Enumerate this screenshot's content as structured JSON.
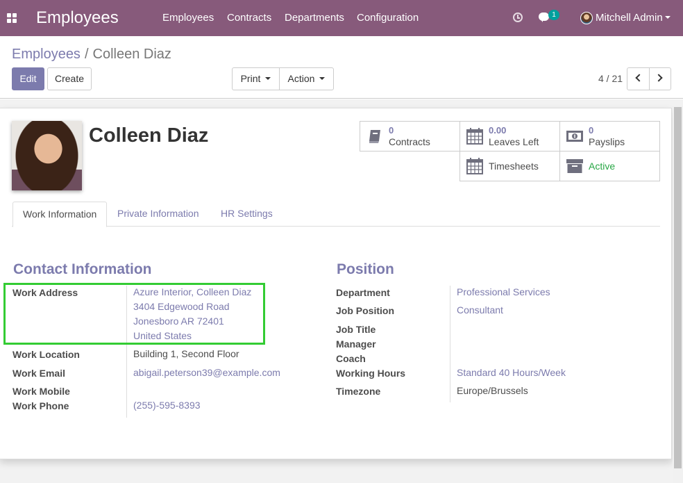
{
  "navbar": {
    "brand": "Employees",
    "menu": [
      "Employees",
      "Contracts",
      "Departments",
      "Configuration"
    ],
    "messages_count": "1",
    "user_name": "Mitchell Admin"
  },
  "breadcrumb": {
    "parent": "Employees",
    "separator": "/",
    "current": "Colleen Diaz"
  },
  "toolbar": {
    "edit_label": "Edit",
    "create_label": "Create",
    "print_label": "Print",
    "action_label": "Action"
  },
  "pager": {
    "value": "4 / 21"
  },
  "employee": {
    "name": "Colleen Diaz"
  },
  "smart_buttons": {
    "contracts": {
      "value": "0",
      "label": "Contracts"
    },
    "leaves": {
      "value": "0.00",
      "label": "Leaves Left"
    },
    "payslips": {
      "value": "0",
      "label": "Payslips"
    },
    "timesheets": {
      "label": "Timesheets"
    },
    "status": {
      "label": "Active"
    }
  },
  "tabs": [
    "Work Information",
    "Private Information",
    "HR Settings"
  ],
  "contact": {
    "title": "Contact Information",
    "work_address_label": "Work Address",
    "work_address": [
      "Azure Interior, Colleen Diaz",
      "3404 Edgewood Road",
      "Jonesboro AR 72401",
      "United States"
    ],
    "work_location_label": "Work Location",
    "work_location": "Building 1, Second Floor",
    "work_email_label": "Work Email",
    "work_email": "abigail.peterson39@example.com",
    "work_mobile_label": "Work Mobile",
    "work_phone_label": "Work Phone",
    "work_phone": "(255)-595-8393"
  },
  "position": {
    "title": "Position",
    "department_label": "Department",
    "department": "Professional Services",
    "job_position_label": "Job Position",
    "job_position": "Consultant",
    "job_title_label": "Job Title",
    "manager_label": "Manager",
    "coach_label": "Coach",
    "working_hours_label": "Working Hours",
    "working_hours": "Standard 40 Hours/Week",
    "timezone_label": "Timezone",
    "timezone": "Europe/Brussels"
  },
  "colors": {
    "brand": "#875a7b",
    "accent": "#7c7bad",
    "active": "#28a745",
    "highlight": "#33cc33"
  },
  "icons": [
    "apps-icon",
    "clock-icon",
    "chat-icon",
    "book-icon",
    "calendar-icon",
    "money-icon",
    "archive-icon",
    "chevron-left-icon",
    "chevron-right-icon"
  ]
}
